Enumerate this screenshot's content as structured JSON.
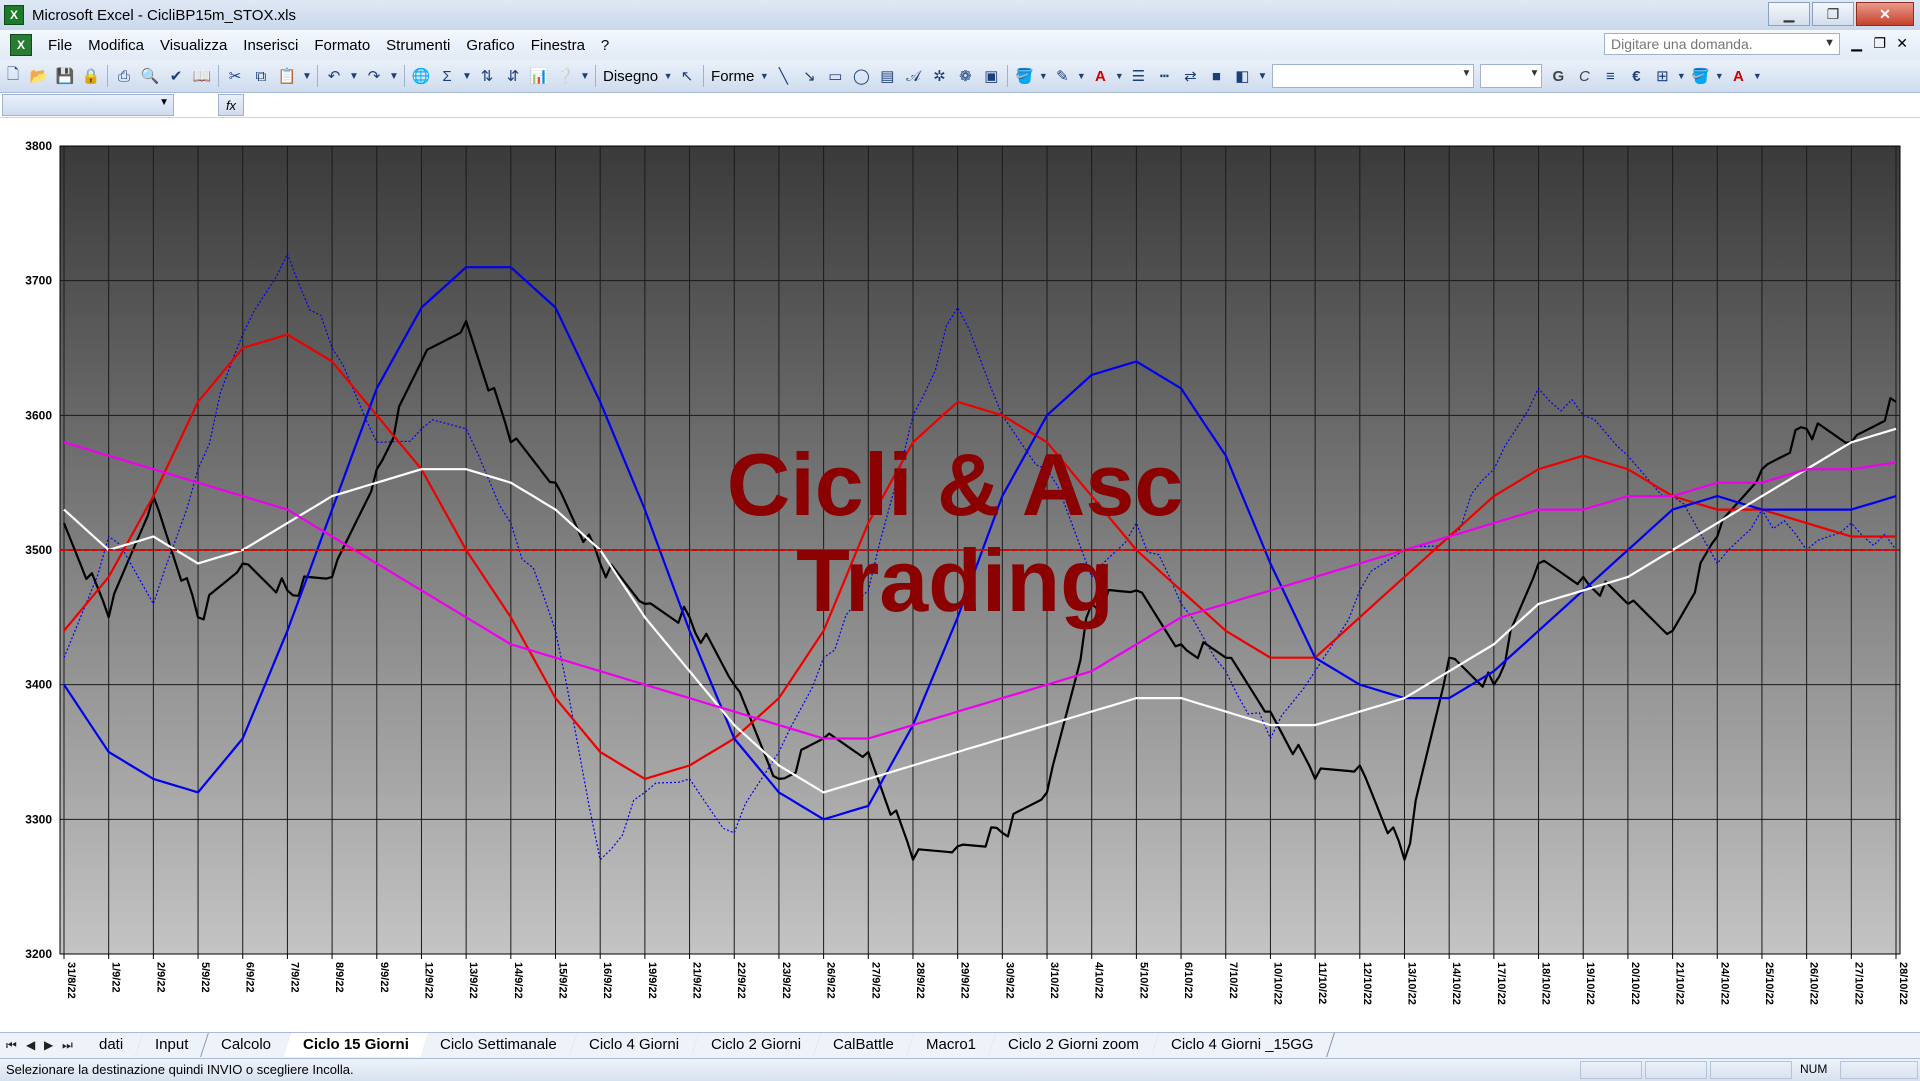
{
  "window": {
    "title": "Microsoft Excel - CicliBP15m_STOX.xls"
  },
  "menu": [
    "File",
    "Modifica",
    "Visualizza",
    "Inserisci",
    "Formato",
    "Strumenti",
    "Grafico",
    "Finestra",
    "?"
  ],
  "help_placeholder": "Digitare una domanda.",
  "toolbar": {
    "disegno": "Disegno",
    "forme": "Forme",
    "bold_g": "G",
    "italic_c": "C",
    "euro": "€"
  },
  "colors": {
    "plot_top": "#3a3a3a",
    "plot_bottom": "#c4c4c4",
    "black": "#000000",
    "blue": "#0000ee",
    "red": "#ee0000",
    "white": "#ffffff",
    "magenta": "#ee00ee",
    "dashed_red": "#dd0000",
    "watermark": "#8b0000"
  },
  "watermark": {
    "line1": "Cicli & Asc",
    "line2": "Trading"
  },
  "chart_data": {
    "type": "line",
    "ylim": [
      3200,
      3800
    ],
    "y_ticks": [
      "3200",
      "3300",
      "3400",
      "3500",
      "3600",
      "3700",
      "3800"
    ],
    "categories": [
      "31/8/22",
      "1/9/22",
      "2/9/22",
      "5/9/22",
      "6/9/22",
      "7/9/22",
      "8/9/22",
      "9/9/22",
      "12/9/22",
      "13/9/22",
      "14/9/22",
      "15/9/22",
      "16/9/22",
      "19/9/22",
      "21/9/22",
      "22/9/22",
      "23/9/22",
      "26/9/22",
      "27/9/22",
      "28/9/22",
      "29/9/22",
      "30/9/22",
      "3/10/22",
      "4/10/22",
      "5/10/22",
      "6/10/22",
      "7/10/22",
      "10/10/22",
      "11/10/22",
      "12/10/22",
      "13/10/22",
      "14/10/22",
      "17/10/22",
      "18/10/22",
      "19/10/22",
      "20/10/22",
      "21/10/22",
      "24/10/22",
      "25/10/22",
      "26/10/22",
      "27/10/22",
      "28/10/22"
    ],
    "reference_line": 3500,
    "grid": true,
    "series": [
      {
        "color": "#000000",
        "style": "solid",
        "values": [
          3520,
          3450,
          3540,
          3450,
          3490,
          3470,
          3480,
          3560,
          3640,
          3670,
          3580,
          3550,
          3490,
          3460,
          3450,
          3400,
          3330,
          3360,
          3350,
          3270,
          3280,
          3290,
          3320,
          3460,
          3470,
          3430,
          3420,
          3380,
          3330,
          3340,
          3270,
          3420,
          3400,
          3490,
          3480,
          3460,
          3440,
          3510,
          3560,
          3590,
          3580,
          3610
        ]
      },
      {
        "color": "#0000ee",
        "style": "dotted",
        "values": [
          3420,
          3510,
          3460,
          3560,
          3660,
          3720,
          3650,
          3580,
          3590,
          3590,
          3520,
          3440,
          3270,
          3320,
          3330,
          3290,
          3350,
          3420,
          3470,
          3600,
          3680,
          3600,
          3560,
          3480,
          3520,
          3460,
          3410,
          3360,
          3410,
          3470,
          3500,
          3510,
          3560,
          3620,
          3600,
          3570,
          3540,
          3490,
          3530,
          3500,
          3520,
          3500
        ]
      },
      {
        "color": "#ee0000",
        "style": "solid",
        "values": [
          3440,
          3480,
          3540,
          3610,
          3650,
          3660,
          3640,
          3600,
          3560,
          3500,
          3450,
          3390,
          3350,
          3330,
          3340,
          3360,
          3390,
          3440,
          3520,
          3580,
          3610,
          3600,
          3580,
          3540,
          3500,
          3470,
          3440,
          3420,
          3420,
          3450,
          3480,
          3510,
          3540,
          3560,
          3570,
          3560,
          3540,
          3530,
          3530,
          3520,
          3510,
          3510
        ]
      },
      {
        "color": "#0000ee",
        "style": "solid",
        "values": [
          3400,
          3350,
          3330,
          3320,
          3360,
          3440,
          3530,
          3620,
          3680,
          3710,
          3710,
          3680,
          3610,
          3530,
          3440,
          3360,
          3320,
          3300,
          3310,
          3370,
          3450,
          3540,
          3600,
          3630,
          3640,
          3620,
          3570,
          3490,
          3420,
          3400,
          3390,
          3390,
          3410,
          3440,
          3470,
          3500,
          3530,
          3540,
          3530,
          3530,
          3530,
          3540
        ]
      },
      {
        "color": "#ffffff",
        "style": "solid",
        "values": [
          3530,
          3500,
          3510,
          3490,
          3500,
          3520,
          3540,
          3550,
          3560,
          3560,
          3550,
          3530,
          3500,
          3450,
          3410,
          3370,
          3340,
          3320,
          3330,
          3340,
          3350,
          3360,
          3370,
          3380,
          3390,
          3390,
          3380,
          3370,
          3370,
          3380,
          3390,
          3410,
          3430,
          3460,
          3470,
          3480,
          3500,
          3520,
          3540,
          3560,
          3580,
          3590
        ]
      },
      {
        "color": "#ee00ee",
        "style": "solid",
        "values": [
          3580,
          3570,
          3560,
          3550,
          3540,
          3530,
          3510,
          3490,
          3470,
          3450,
          3430,
          3420,
          3410,
          3400,
          3390,
          3380,
          3370,
          3360,
          3360,
          3370,
          3380,
          3390,
          3400,
          3410,
          3430,
          3450,
          3460,
          3470,
          3480,
          3490,
          3500,
          3510,
          3520,
          3530,
          3530,
          3540,
          3540,
          3550,
          3550,
          3560,
          3560,
          3565
        ]
      }
    ]
  },
  "sheet_tabs": [
    "dati",
    "Input",
    "Calcolo",
    "Ciclo 15 Giorni",
    "Ciclo Settimanale",
    "Ciclo 4 Giorni",
    "Ciclo 2 Giorni",
    "CalBattle",
    "Macro1",
    "Ciclo 2 Giorni zoom",
    "Ciclo 4 Giorni _15GG"
  ],
  "active_tab": "Ciclo 15 Giorni",
  "status": {
    "message": "Selezionare la destinazione quindi INVIO o scegliere Incolla.",
    "num": "NUM"
  }
}
